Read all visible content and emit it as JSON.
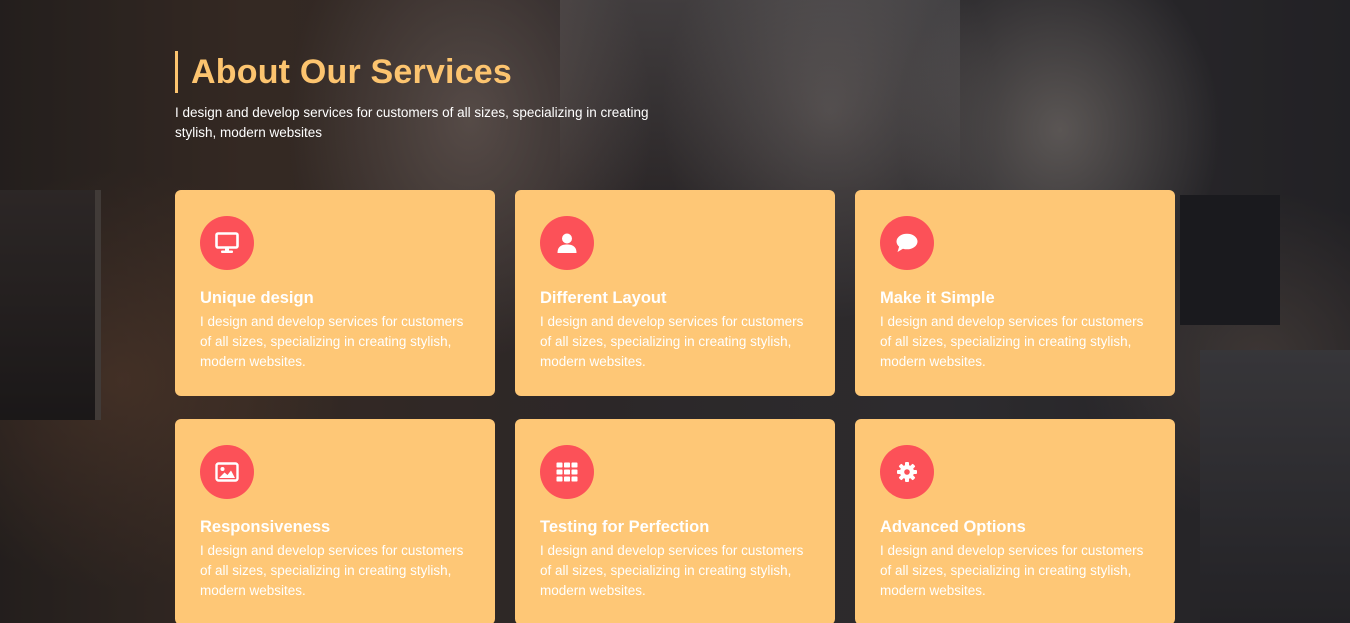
{
  "section": {
    "title": "About Our Services",
    "subtitle": "I design and develop services for customers of all sizes, specializing in creating stylish, modern websites"
  },
  "colors": {
    "accent": "#fcc46f",
    "card_background": "#fec776",
    "icon_background": "#fc5158",
    "text": "#ffffff"
  },
  "cards": [
    {
      "icon": "monitor-icon",
      "title": "Unique design",
      "text": "I design and develop services for customers of all sizes, specializing in creating stylish, modern websites."
    },
    {
      "icon": "user-icon",
      "title": "Different Layout",
      "text": "I design and develop services for customers of all sizes, specializing in creating stylish, modern websites."
    },
    {
      "icon": "chat-bubble-icon",
      "title": "Make it Simple",
      "text": "I design and develop services for customers of all sizes, specializing in creating stylish, modern websites."
    },
    {
      "icon": "image-icon",
      "title": "Responsiveness",
      "text": "I design and develop services for customers of all sizes, specializing in creating stylish, modern websites."
    },
    {
      "icon": "grid-icon",
      "title": "Testing for Perfection",
      "text": "I design and develop services for customers of all sizes, specializing in creating stylish, modern websites."
    },
    {
      "icon": "gear-icon",
      "title": "Advanced Options",
      "text": "I design and develop services for customers of all sizes, specializing in creating stylish, modern websites."
    }
  ]
}
